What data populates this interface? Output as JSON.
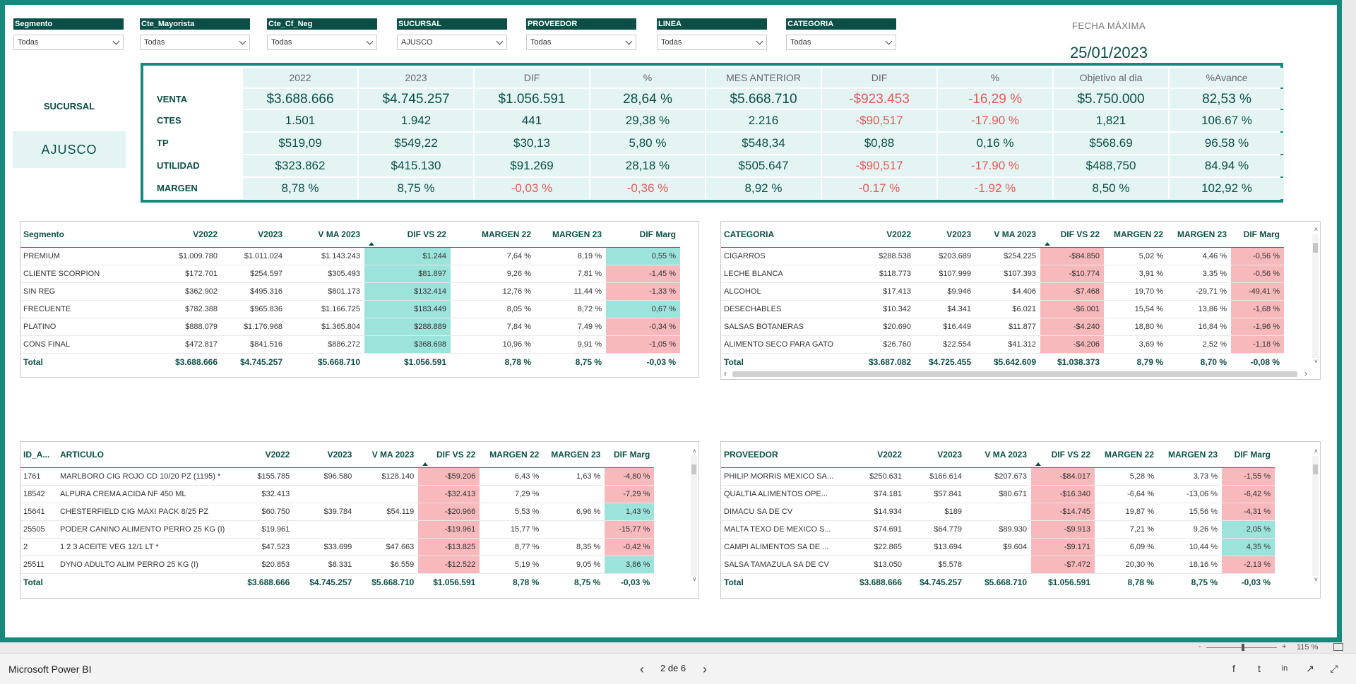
{
  "filters": [
    {
      "label": "Segmento",
      "value": "Todas"
    },
    {
      "label": "Cte_Mayorista",
      "value": "Todas"
    },
    {
      "label": "Cte_Cf_Neg",
      "value": "Todas"
    },
    {
      "label": "SUCURSAL",
      "value": "AJUSCO"
    },
    {
      "label": "PROVEEDOR",
      "value": "Todas"
    },
    {
      "label": "LINEA",
      "value": "Todas"
    },
    {
      "label": "CATEGORIA",
      "value": "Todas"
    }
  ],
  "fecha": {
    "label": "FECHA MÁXIMA",
    "value": "25/01/2023"
  },
  "sucursal": {
    "label": "SUCURSAL",
    "value": "AJUSCO"
  },
  "kpi": {
    "headers": [
      "2022",
      "2023",
      "DIF",
      "%",
      "MES ANTERIOR",
      "DIF",
      "%",
      "Objetivo al dia",
      "%Avance"
    ],
    "rows": [
      {
        "label": "VENTA",
        "values": [
          "$3.688.666",
          "$4.745.257",
          "$1.056.591",
          "28,64 %",
          "$5.668.710",
          "-$923.453",
          "-16,29 %",
          "$5.750.000",
          "82,53 %"
        ]
      },
      {
        "label": "CTES",
        "values": [
          "1.501",
          "1.942",
          "441",
          "29,38 %",
          "2.216",
          "-$90,517",
          "-17.90 %",
          "1,821",
          "106.67 %"
        ]
      },
      {
        "label": "TP",
        "values": [
          "$519,09",
          "$549,22",
          "$30,13",
          "5,80 %",
          "$548,34",
          "$0,88",
          "0,16 %",
          "$568.69",
          "96.58 %"
        ]
      },
      {
        "label": "UTILIDAD",
        "values": [
          "$323.862",
          "$415.130",
          "$91.269",
          "28,18 %",
          "$505.647",
          "-$90,517",
          "-17.90 %",
          "$488,750",
          "84.94 %"
        ]
      },
      {
        "label": "MARGEN",
        "values": [
          "8,78 %",
          "8,75 %",
          "-0,03 %",
          "-0,36 %",
          "8,92 %",
          "-0.17 %",
          "-1.92 %",
          "8,50 %",
          "102,92 %"
        ]
      }
    ]
  },
  "segmento_table": {
    "headers": [
      "Segmento",
      "V2022",
      "V2023",
      "V MA 2023",
      "DIF VS 22",
      "MARGEN 22",
      "MARGEN 23",
      "DIF Marg"
    ],
    "rows": [
      [
        "PREMIUM",
        "$1.009.780",
        "$1.011.024",
        "$1.143.243",
        "$1.244",
        "7,64 %",
        "8,19 %",
        "0,55 %"
      ],
      [
        "CLIENTE SCORPION",
        "$172.701",
        "$254.597",
        "$305.493",
        "$81.897",
        "9,26 %",
        "7,81 %",
        "-1,45 %"
      ],
      [
        "SIN REG",
        "$362.902",
        "$495.316",
        "$801.173",
        "$132.414",
        "12,76 %",
        "11,44 %",
        "-1,33 %"
      ],
      [
        "FRECUENTE",
        "$782.388",
        "$965.836",
        "$1.166.725",
        "$183.449",
        "8,05 %",
        "8,72 %",
        "0,67 %"
      ],
      [
        "PLATINO",
        "$888.079",
        "$1.176.968",
        "$1.365.804",
        "$288.889",
        "7,84 %",
        "7,49 %",
        "-0,34 %"
      ],
      [
        "CONS FINAL",
        "$472.817",
        "$841.516",
        "$886.272",
        "$368.698",
        "10,96 %",
        "9,91 %",
        "-1,05 %"
      ]
    ],
    "total": [
      "Total",
      "$3.688.666",
      "$4.745.257",
      "$5.668.710",
      "$1.056.591",
      "8,78 %",
      "8,75 %",
      "-0,03 %"
    ]
  },
  "categoria_table": {
    "headers": [
      "CATEGORIA",
      "V2022",
      "V2023",
      "V MA 2023",
      "DIF VS 22",
      "MARGEN 22",
      "MARGEN 23",
      "DIF Marg"
    ],
    "rows": [
      [
        "CIGARROS",
        "$288.538",
        "$203.689",
        "$254.225",
        "-$84.850",
        "5,02 %",
        "4,46 %",
        "-0,56 %"
      ],
      [
        "LECHE BLANCA",
        "$118.773",
        "$107.999",
        "$107.393",
        "-$10.774",
        "3,91 %",
        "3,35 %",
        "-0,56 %"
      ],
      [
        "ALCOHOL",
        "$17.413",
        "$9.946",
        "$4.406",
        "-$7.468",
        "19,70 %",
        "-29,71 %",
        "-49,41 %"
      ],
      [
        "DESECHABLES",
        "$10.342",
        "$4.341",
        "$6.021",
        "-$6.001",
        "15,54 %",
        "13,86 %",
        "-1,68 %"
      ],
      [
        "SALSAS BOTANERAS",
        "$20.690",
        "$16.449",
        "$11.877",
        "-$4.240",
        "18,80 %",
        "16,84 %",
        "-1,96 %"
      ],
      [
        "ALIMENTO SECO PARA GATO",
        "$26.760",
        "$22.554",
        "$41.312",
        "-$4.206",
        "3,69 %",
        "2,52 %",
        "-1,18 %"
      ]
    ],
    "total": [
      "Total",
      "$3.687.082",
      "$4.725.455",
      "$5.642.609",
      "$1.038.373",
      "8,79 %",
      "8,70 %",
      "-0,08 %"
    ]
  },
  "articulo_table": {
    "headers": [
      "ID_A...",
      "ARTICULO",
      "V2022",
      "V2023",
      "V MA 2023",
      "DIF VS 22",
      "MARGEN 22",
      "MARGEN 23",
      "DIF Marg"
    ],
    "rows": [
      [
        "1761",
        "MARLBORO CIG ROJO CD 10/20 PZ (1195) *",
        "$155.785",
        "$96.580",
        "$128.140",
        "-$59.206",
        "6,43 %",
        "1,63 %",
        "-4,80 %"
      ],
      [
        "18542",
        "ALPURA CREMA ACIDA NF 450 ML",
        "$32.413",
        "",
        "",
        "-$32.413",
        "7,29 %",
        "",
        "-7,29 %"
      ],
      [
        "15641",
        "CHESTERFIELD CIG MAXI PACK 8/25 PZ",
        "$60.750",
        "$39.784",
        "$54.119",
        "-$20.966",
        "5,53 %",
        "6,96 %",
        "1,43 %"
      ],
      [
        "25505",
        "PODER CANINO ALIMENTO PERRO 25 KG (I)",
        "$19.961",
        "",
        "",
        "-$19.961",
        "15,77 %",
        "",
        "-15,77 %"
      ],
      [
        "2",
        "1 2 3 ACEITE VEG 12/1 LT *",
        "$47.523",
        "$33.699",
        "$47.663",
        "-$13.825",
        "8,77 %",
        "8,35 %",
        "-0,42 %"
      ],
      [
        "25511",
        "DYNO ADULTO ALIM PERRO 25 KG (I)",
        "$20.853",
        "$8.331",
        "$6.559",
        "-$12.522",
        "5,19 %",
        "9,05 %",
        "3,86 %"
      ]
    ],
    "total": [
      "Total",
      "",
      "$3.688.666",
      "$4.745.257",
      "$5.668.710",
      "$1.056.591",
      "8,78 %",
      "8,75 %",
      "-0,03 %"
    ]
  },
  "proveedor_table": {
    "headers": [
      "PROVEEDOR",
      "V2022",
      "V2023",
      "V MA 2023",
      "DIF VS 22",
      "MARGEN 22",
      "MARGEN 23",
      "DIF Marg"
    ],
    "rows": [
      [
        "PHILIP MORRIS MEXICO SA...",
        "$250.631",
        "$166.614",
        "$207.673",
        "-$84.017",
        "5,28 %",
        "3,73 %",
        "-1,55 %"
      ],
      [
        "QUALTIA ALIMENTOS OPE...",
        "$74.181",
        "$57.841",
        "$80.671",
        "-$16.340",
        "-6,64 %",
        "-13,06 %",
        "-6,42 %"
      ],
      [
        "DIMACU SA DE CV",
        "$14.934",
        "$189",
        "",
        "-$14.745",
        "19,87 %",
        "15,56 %",
        "-4,31 %"
      ],
      [
        "MALTA TEXO DE MEXICO S...",
        "$74.691",
        "$64.779",
        "$89.930",
        "-$9.913",
        "7,21 %",
        "9,26 %",
        "2,05 %"
      ],
      [
        "CAMPI ALIMENTOS SA DE ...",
        "$22.865",
        "$13.694",
        "$9.604",
        "-$9.171",
        "6,09 %",
        "10,44 %",
        "4,35 %"
      ],
      [
        "SALSA TAMAZULA SA DE CV",
        "$13.050",
        "$5.578",
        "",
        "-$7.472",
        "20,30 %",
        "18,16 %",
        "-2,13 %"
      ]
    ],
    "total": [
      "Total",
      "$3.688.666",
      "$4.745.257",
      "$5.668.710",
      "$1.056.591",
      "8,78 %",
      "8,75 %",
      "-0,03 %"
    ]
  },
  "footer": {
    "app_name": "Microsoft Power BI",
    "page": "2 de 6",
    "zoom": "115 %"
  },
  "colors": {
    "accent": "#17897c",
    "dark": "#0b4f46",
    "positive": "#9ce3dc",
    "negative": "#f7b9bb",
    "neg_text": "#e55a5a"
  }
}
